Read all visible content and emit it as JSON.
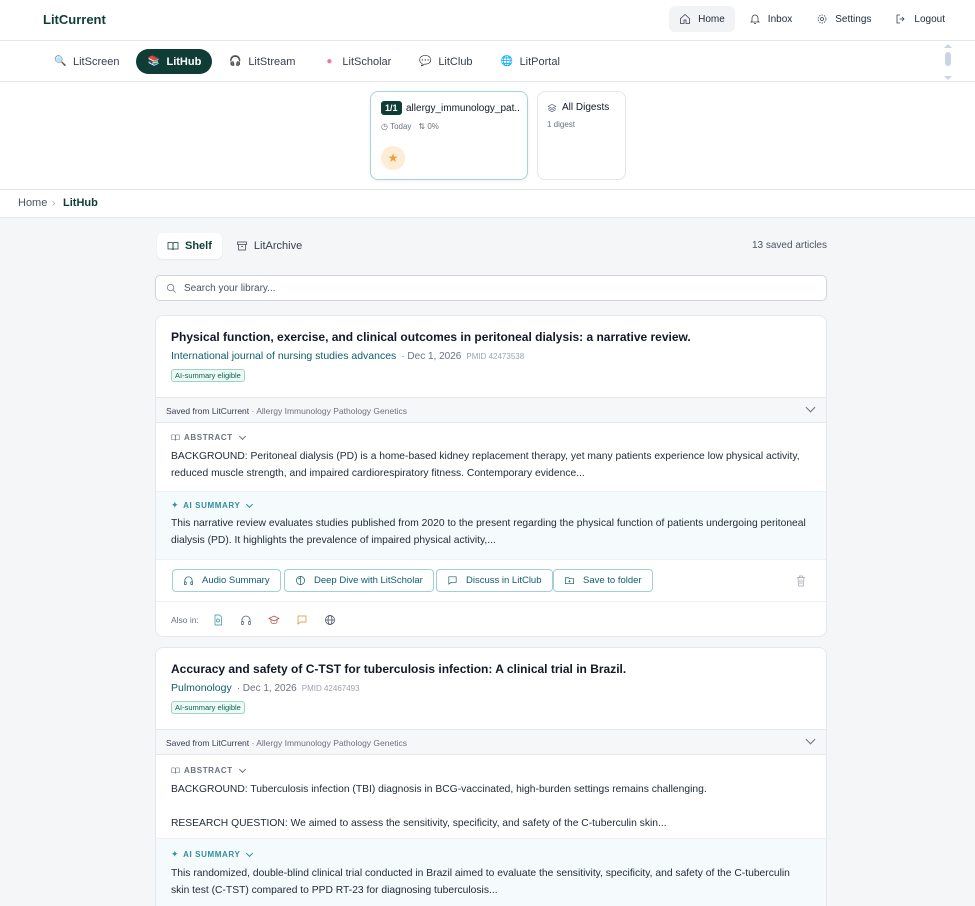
{
  "app": {
    "brand": "LitCurrent"
  },
  "topnav": [
    {
      "label": "Home",
      "icon": "home-icon"
    },
    {
      "label": "Inbox",
      "icon": "bell-icon"
    },
    {
      "label": "Settings",
      "icon": "gear-icon"
    },
    {
      "label": "Logout",
      "icon": "logout-icon"
    }
  ],
  "product_tabs": [
    {
      "label": "LitScreen",
      "icon": "magnifier-icon"
    },
    {
      "label": "LitHub",
      "icon": "books-icon"
    },
    {
      "label": "LitStream",
      "icon": "headphones-icon"
    },
    {
      "label": "LitScholar",
      "icon": "brain-icon"
    },
    {
      "label": "LitClub",
      "icon": "speech-bubble-icon"
    },
    {
      "label": "LitPortal",
      "icon": "globe-icon"
    }
  ],
  "digests": {
    "selected": {
      "badge": "1/1",
      "name": "allergy_immunology_pat...",
      "when": "Today",
      "percent": "0%"
    },
    "all": {
      "title": "All Digests",
      "subtitle": "1 digest"
    }
  },
  "breadcrumb": {
    "home": "Home",
    "separator": "›",
    "current": "LitHub"
  },
  "view_tabs": {
    "shelf": "Shelf",
    "archive": "LitArchive"
  },
  "saved_count": "13 saved articles",
  "search": {
    "placeholder": "Search your library..."
  },
  "articles": [
    {
      "title": "Physical function, exercise, and clinical outcomes in peritoneal dialysis: a narrative review.",
      "journal": "International journal of nursing studies advances",
      "date": "· Dec 1, 2026",
      "pmid": "PMID 42473538",
      "tag": "AI-summary eligible",
      "saved_from": "Saved from LitCurrent",
      "saved_topic": " · Allergy Immunology Pathology Genetics",
      "abstract_label": "ABSTRACT",
      "abstract": "BACKGROUND: Peritoneal dialysis (PD) is a home-based kidney replacement therapy, yet many patients experience low physical activity, reduced muscle strength, and impaired cardiorespiratory fitness. Contemporary evidence...",
      "ai_label": "AI SUMMARY",
      "ai_summary": "This narrative review evaluates studies published from 2020 to the present regarding the physical function of patients undergoing peritoneal dialysis (PD). It highlights the prevalence of impaired physical activity,...",
      "actions": {
        "audio": "Audio Summary",
        "deep_dive": "Deep Dive with LitScholar",
        "discuss": "Discuss in LitClub",
        "save": "Save to folder"
      },
      "also_in": "Also in:"
    },
    {
      "title": "Accuracy and safety of C-TST for tuberculosis infection: A clinical trial in Brazil.",
      "journal": "Pulmonology",
      "date": "· Dec 1, 2026",
      "pmid": "PMID 42467493",
      "tag": "AI-summary eligible",
      "saved_from": "Saved from LitCurrent",
      "saved_topic": " · Allergy Immunology Pathology Genetics",
      "abstract_label": "ABSTRACT",
      "abstract_p1": "BACKGROUND: Tuberculosis infection (TBI) diagnosis in BCG-vaccinated, high-burden settings remains challenging.",
      "abstract_p2": "RESEARCH QUESTION: We aimed to assess the sensitivity, specificity, and safety of the C-tuberculin skin...",
      "ai_label": "AI SUMMARY",
      "ai_summary": "This randomized, double-blind clinical trial conducted in Brazil aimed to evaluate the sensitivity, specificity, and safety of the C-tuberculin skin test (C-TST) compared to PPD RT-23 for diagnosing tuberculosis..."
    }
  ],
  "colors": {
    "brand": "#0f3d36",
    "accent": "#0f5e69",
    "ai": "#2f8fa0"
  }
}
